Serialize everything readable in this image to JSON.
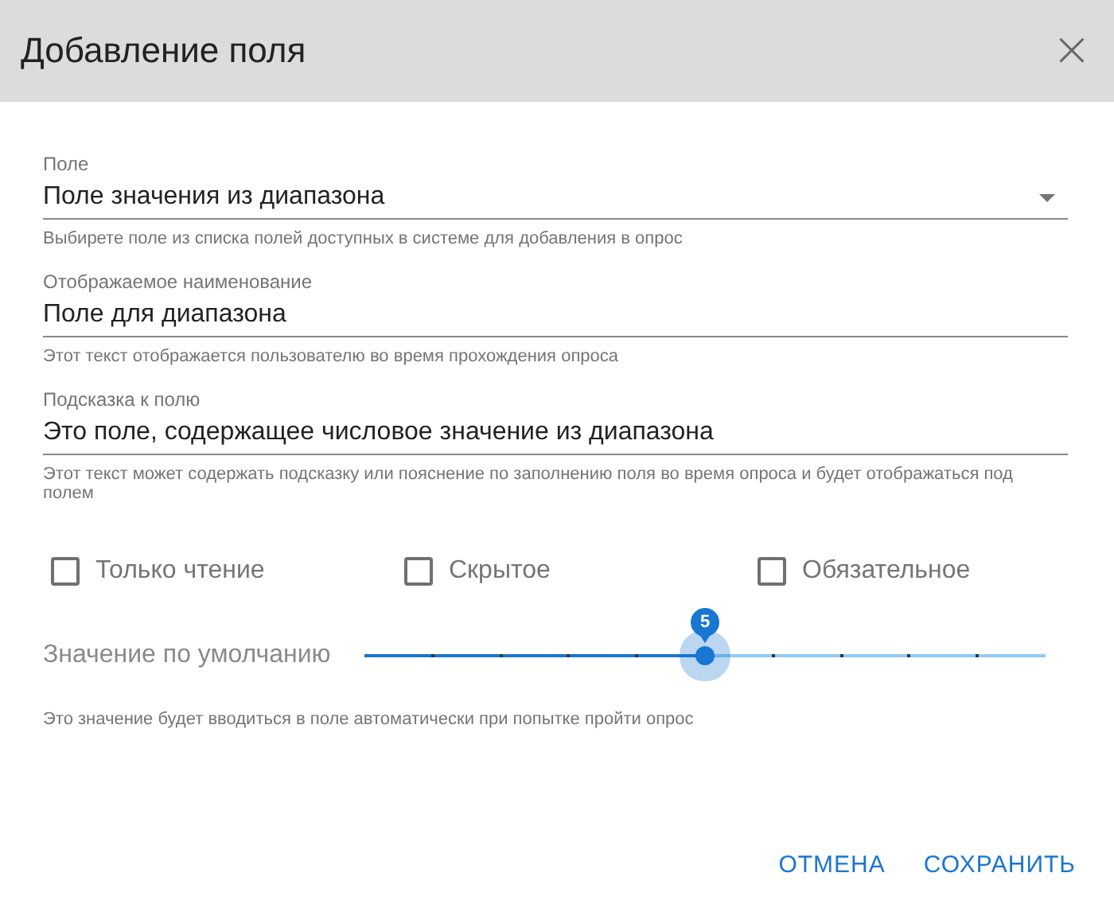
{
  "dialog": {
    "title": "Добавление поля",
    "close": "×"
  },
  "fields": [
    {
      "kind": "select",
      "label": "Поле",
      "value": "Поле значения из диапазона",
      "helper": "Выбирете поле из списка полей доступных в системе для добавления в опрос"
    },
    {
      "kind": "text",
      "label": "Отображаемое наименование",
      "value": "Поле для диапазона",
      "helper": "Этот текст отображается пользователю во время прохождения опроса"
    },
    {
      "kind": "text",
      "label": "Подсказка к полю",
      "value": "Это поле, содержащее числовое значение из диапазона",
      "helper": "Этот текст может содержать подсказку или пояснение по заполнению поля во время опроса и будет отображаться под полем"
    }
  ],
  "checkboxes": [
    {
      "label": "Только чтение",
      "checked": false
    },
    {
      "label": "Скрытое",
      "checked": false
    },
    {
      "label": "Обязательное",
      "checked": false
    }
  ],
  "slider": {
    "label": "Значение по умолчанию",
    "value": "5",
    "level": 0.5,
    "helper": "Это значение будет вводиться в поле автоматически при попытке пройти опрос"
  },
  "buttons": [
    "ОТМЕНА",
    "СОХРАНИТЬ"
  ]
}
